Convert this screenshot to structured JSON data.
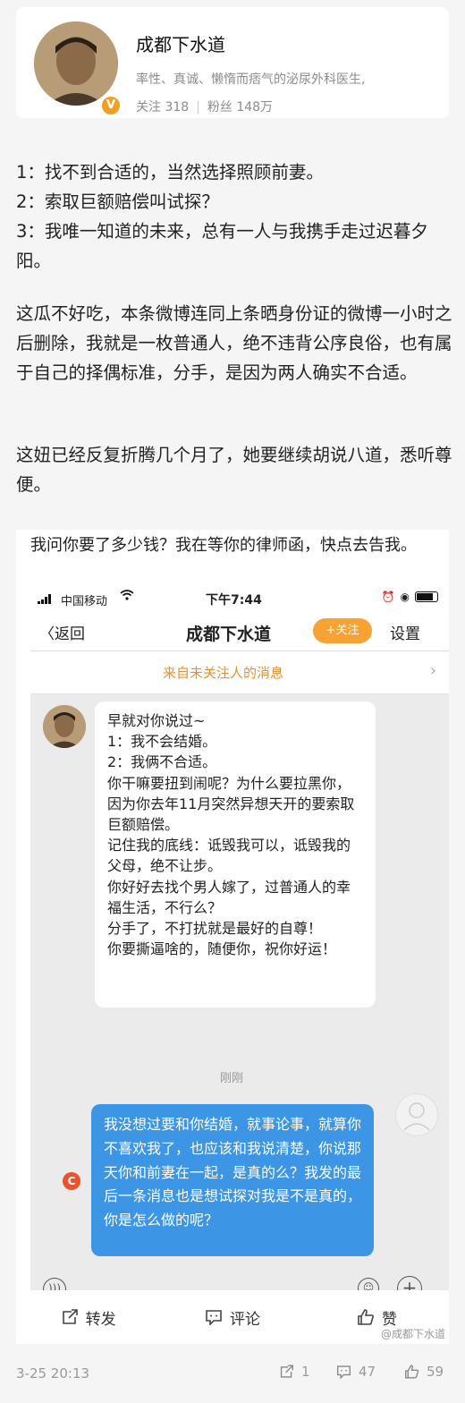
{
  "profile": {
    "name": "成都下水道",
    "bio": "率性、真诚、懒惰而痞气的泌尿外科医生,",
    "follow_count": "关注 318",
    "fans_count": "粉丝 148万"
  },
  "post": {
    "paragraph_1": "1：找不到合适的，当然选择照顾前妻。\n2：索取巨额赔偿叫试探？\n3：我唯一知道的未来，总有一人与我携手走过迟暮夕阳。",
    "paragraph_2": "这瓜不好吃，本条微博连同上条晒身份证的微博一小时之后删除，我就是一枚普通人，绝不违背公序良俗，也有属于自己的择偶标准，分手，是因为两人确实不合适。",
    "paragraph_3": "这妞已经反复折腾几个月了，她要继续胡说八道，悉听尊便。"
  },
  "screenshot": {
    "caption": "我问你要了多少钱？我在等你的律师函，快点去告我。",
    "status_bar": {
      "carrier": "中国移动",
      "time": "下午7:44"
    },
    "nav": {
      "back_label": "返回",
      "title": "成都下水道",
      "follow_label": "+关注",
      "settings_label": "设置"
    },
    "notice": "来自未关注人的消息",
    "incoming_message": "早就对你说过~\n1：我不会结婚。\n2：我俩不合适。\n你干嘛要扭到闹呢？为什么要拉黑你，因为你去年11月突然异想天开的要索取巨额赔偿。\n记住我的底线：诋毁我可以，诋毁我的父母，绝不让步。\n你好好去找个男人嫁了，过普通人的幸福生活，不行么？\n分手了，不打扰就是最好的自尊！\n你要撕逼啥的，随便你，祝你好运！",
    "time_divider": "刚刚",
    "outgoing_message": "我没想过要和你结婚，就事论事，就算你不喜欢我了，也应该和我说清楚，你说那天你和前妻在一起，是真的么？我发的最后一条消息也是想试探对我是不是真的，你是怎么做的呢？",
    "actions": {
      "repost": "转发",
      "comment": "评论",
      "like": "赞"
    },
    "watermark": "@成都下水道"
  },
  "footer": {
    "timestamp": "3-25 20:13",
    "reposts": "1",
    "comments": "47",
    "likes": "59"
  },
  "colors": {
    "follow_button": "#f7a233",
    "notice_text": "#e8902f",
    "outgoing_bubble": "#3d95e6",
    "error_icon": "#e9512f",
    "verified_badge": "#f0a020"
  }
}
